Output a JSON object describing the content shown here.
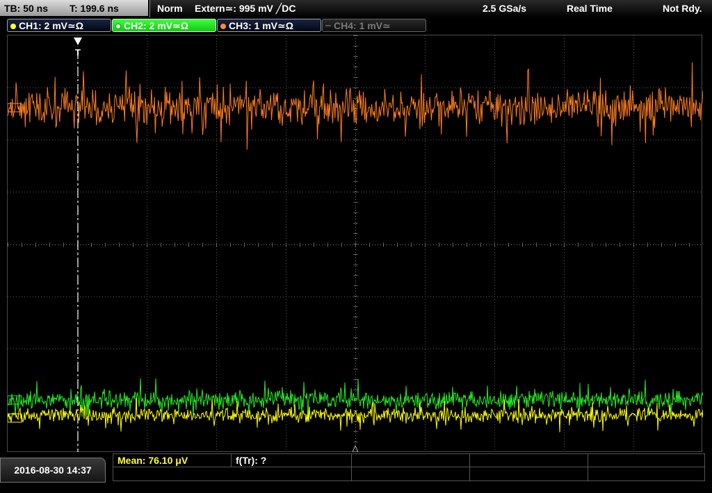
{
  "top_bar": {
    "timebase": "TB: 50 ns",
    "trigger_time": "T: 199.6 ns",
    "acq_mode": "Norm",
    "trigger_source": "Extern≃: 995 mV ╱DC",
    "sample_rate": "2.5 GSa/s",
    "acq_type": "Real Time",
    "status": "Not Rdy."
  },
  "channels": [
    {
      "label": "CH1: 2 mV≃Ω",
      "color": "#ffff33",
      "state": "on"
    },
    {
      "label": "CH2: 2 mV≃Ω",
      "color": "#33ff33",
      "state": "active"
    },
    {
      "label": "CH3: 1 mV≃Ω",
      "color": "#ff8a2a",
      "state": "on"
    },
    {
      "label": "CH4: 1 mV≃",
      "color": "#7a7a7a",
      "state": "off"
    }
  ],
  "trace_colors": {
    "ch1": "#ffff00",
    "ch2": "#22ee22",
    "ch3": "#ff7f20"
  },
  "trigger_marker": "T",
  "bottom_bar": {
    "datetime": "2016-08-30 14:37",
    "measurements": [
      {
        "label": "Mean: 76.10 μV",
        "color": "#ffff33"
      },
      {
        "label": "f(Tr): ?",
        "color": "#ffffff"
      }
    ]
  }
}
